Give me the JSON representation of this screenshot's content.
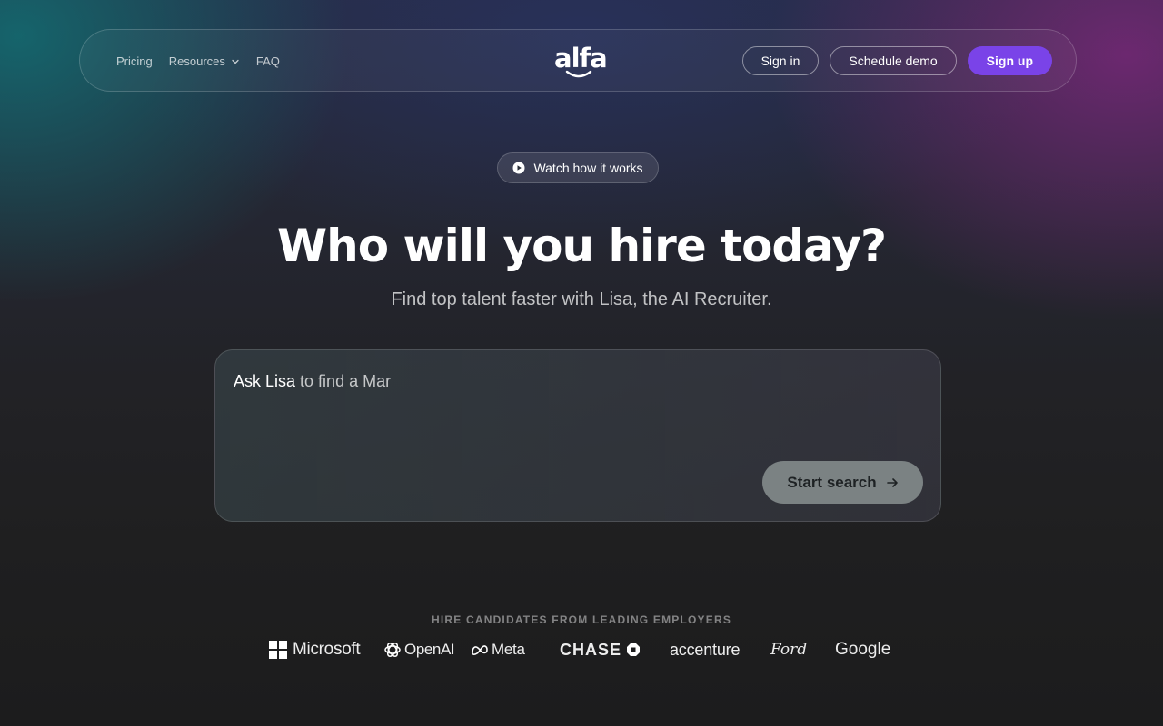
{
  "nav": {
    "links": [
      "Pricing",
      "Resources",
      "FAQ"
    ],
    "logo_text": "alfa",
    "sign_in": "Sign in",
    "schedule_demo": "Schedule demo",
    "sign_up": "Sign up"
  },
  "watch_button": "Watch how it works",
  "hero": {
    "title": "Who will you hire today?",
    "subtitle": "Find top talent faster with Lisa, the AI Recruiter."
  },
  "search": {
    "prefix": "Ask Lisa",
    "typed_text": "to find a Mar",
    "start_button": "Start search"
  },
  "employers": {
    "heading": "HIRE CANDIDATES FROM LEADING EMPLOYERS",
    "logos": [
      "Microsoft",
      "OpenAI",
      "Meta",
      "CHASE",
      "accenture",
      "Ford",
      "Google"
    ]
  },
  "colors": {
    "primary_button": "#7a43e8",
    "start_button": "#7b8283"
  }
}
